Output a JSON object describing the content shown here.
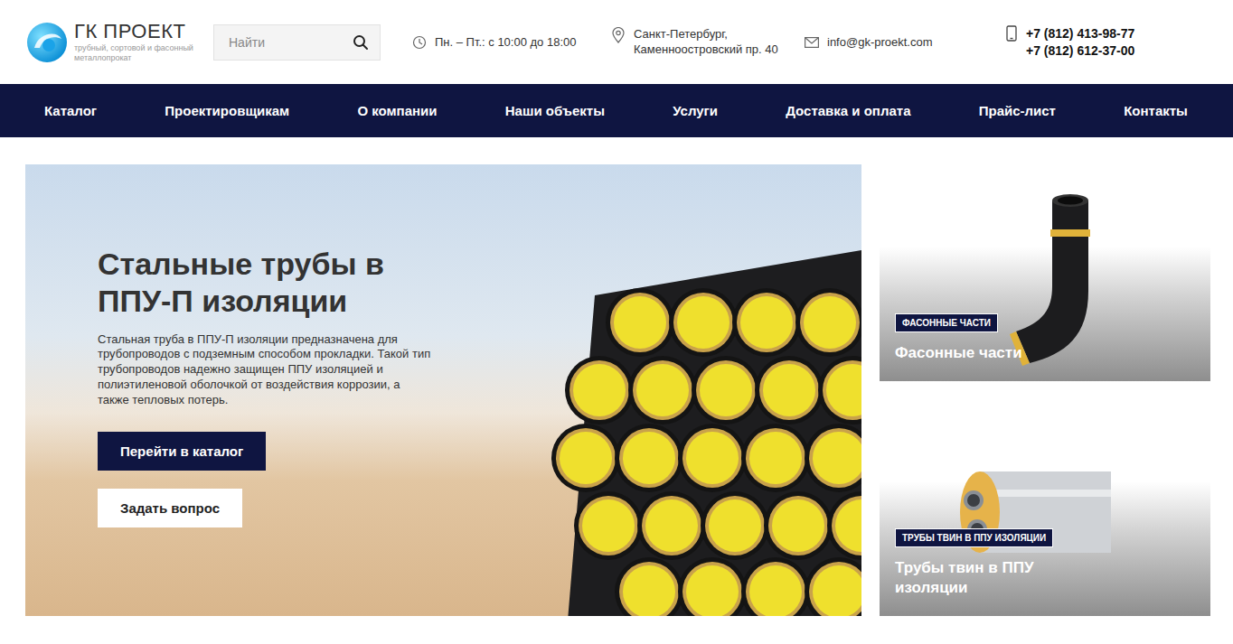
{
  "logo": {
    "title": "ГК ПРОЕКТ",
    "subtitle": "трубный, сортовой и фасонный металлопрокат"
  },
  "search": {
    "placeholder": "Найти"
  },
  "hours": "Пн. – Пт.: с 10:00 до 18:00",
  "address": [
    "Санкт-Петербург,",
    "Каменноостровский пр. 40"
  ],
  "email": "info@gk-proekt.com",
  "phones": [
    "+7 (812) 413-98-77",
    "+7 (812) 612-37-00"
  ],
  "nav": [
    "Каталог",
    "Проектировщикам",
    "О компании",
    "Наши объекты",
    "Услуги",
    "Доставка и оплата",
    "Прайс-лист",
    "Контакты"
  ],
  "hero": {
    "title": "Стальные трубы в ППУ-П изоляции",
    "text": "Стальная труба в ППУ-П изоляции предназначена для трубопроводов с подземным способом прокладки. Такой тип трубопроводов надежно защищен ППУ изоляцией и полиэтиленовой оболочкой от воздействия коррозии, а также тепловых потерь.",
    "buttons": [
      {
        "label": "Перейти в каталог",
        "kind": "primary"
      },
      {
        "label": "Задать вопрос",
        "kind": "secondary"
      }
    ]
  },
  "cards": [
    {
      "tag": "ФАСОННЫЕ ЧАСТИ",
      "title": "Фасонные части",
      "kind": "elbow"
    },
    {
      "tag": "ТРУБЫ ТВИН В ППУ ИЗОЛЯЦИИ",
      "title": "Трубы твин в ППУ изоляции",
      "kind": "twin"
    }
  ]
}
